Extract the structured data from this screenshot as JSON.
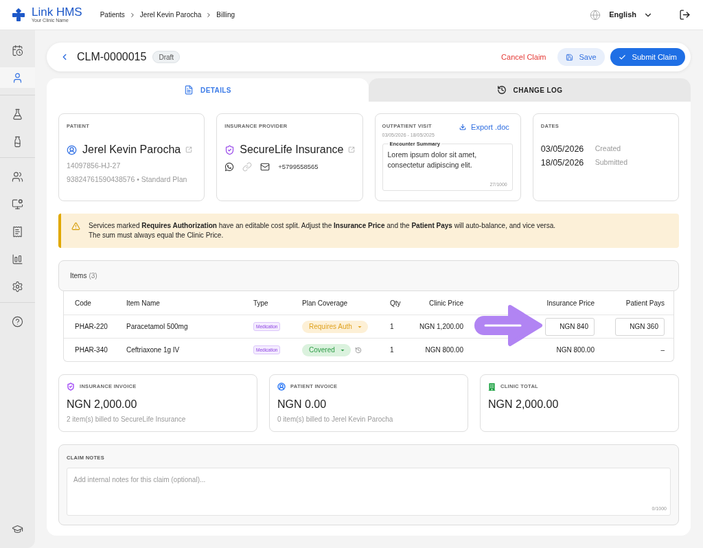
{
  "top_bar": {
    "logo": {
      "name": "Link HMS",
      "subtitle": "Your Clinic Name"
    },
    "breadcrumbs": [
      "Patients",
      "Jerel Kevin Parocha",
      "Billing"
    ],
    "language": "English"
  },
  "sidebar": {
    "groups": [
      {
        "items": [
          {
            "selected": false
          },
          {
            "selected": true
          }
        ]
      },
      {
        "items": [
          {
            "selected": false
          },
          {
            "selected": false
          }
        ]
      },
      {
        "items": [
          {
            "selected": false
          },
          {
            "selected": false
          },
          {
            "selected": false
          },
          {
            "selected": false
          },
          {
            "selected": false
          }
        ]
      },
      {
        "items": [
          {
            "selected": false
          }
        ]
      }
    ],
    "bottom_item": {
      "selected": false
    }
  },
  "header": {
    "claim_id": "CLM-0000015",
    "status": "Draft",
    "actions": [
      {
        "kind": "text",
        "label": "Cancel Claim"
      },
      {
        "kind": "secondary",
        "label": "Save"
      },
      {
        "kind": "primary",
        "label": "Submit Claim"
      }
    ]
  },
  "tabs": [
    {
      "label": "DETAILS",
      "selected": true
    },
    {
      "label": "CHANGE LOG",
      "selected": false
    }
  ],
  "patient_card": {
    "label": "PATIENT",
    "name": "Jerel Kevin Parocha",
    "patient_id": "14097856-HJ-27",
    "details": "93824761590438576 • Standard Plan"
  },
  "insurance_card": {
    "label": "INSURANCE PROVIDER",
    "name": "SecureLife Insurance",
    "contacts": [
      {
        "disabled": false
      },
      {
        "disabled": true
      },
      {
        "disabled": false
      }
    ],
    "phone": "+5799558565"
  },
  "visit_card": {
    "label": "OUTPATIENT VISIT",
    "date_range": "03/05/2026 - 18/05/2025",
    "export_label": "Export .doc",
    "summary": {
      "label": "Encounter Summary",
      "value": "Lorem ipsum dolor sit amet, consectetur adipiscing elit.",
      "counter": "27/1000"
    }
  },
  "dates_card": {
    "label": "DATES",
    "entries": [
      {
        "date": "03/05/2026",
        "event": "Created"
      },
      {
        "date": "18/05/2026",
        "event": "Submitted"
      }
    ]
  },
  "alert": {
    "lines": [
      "Services marked **Requires Authorization** have an editable cost split. Adjust the **Insurance Price** and the **Patient Pays** will auto-balance, and vice versa.",
      "The sum must always equal the Clinic Price."
    ]
  },
  "items": {
    "title": "Items",
    "count": "(3)",
    "columns": [
      "Code",
      "Item Name",
      "Type",
      "Plan Coverage",
      "Qty",
      "Clinic Price",
      "Insurance Price",
      "Patient Pays"
    ],
    "rows": [
      {
        "code": "PHAR-220",
        "name": "Paracetamol 500mg",
        "type": "Medication",
        "coverage": {
          "label": "Requires Auth",
          "kind": "auth",
          "history": false
        },
        "qty": "1",
        "clinic_price": "NGN 1,200.00",
        "editable": true,
        "insurance_price": "NGN 840",
        "patient_pays": "NGN 360"
      },
      {
        "code": "PHAR-340",
        "name": "Ceftriaxone 1g IV",
        "type": "Medication",
        "coverage": {
          "label": "Covered",
          "kind": "covered",
          "history": true
        },
        "qty": "1",
        "clinic_price": "NGN 800.00",
        "editable": false,
        "insurance_price": "NGN 800.00",
        "patient_pays": "–"
      }
    ]
  },
  "invoices": [
    {
      "label": "INSURANCE INVOICE",
      "color": "#a855f7",
      "amount": "NGN 2,000.00",
      "note": "2 item(s) billed to SecureLife Insurance"
    },
    {
      "label": "PATIENT INVOICE",
      "color": "#3b82f6",
      "amount": "NGN 0.00",
      "note": "0 item(s) billed to Jerel Kevin Parocha"
    },
    {
      "label": "CLINIC TOTAL",
      "color": "#22a447",
      "amount": "NGN 2,000.00"
    }
  ],
  "notes": {
    "label": "CLAIM NOTES",
    "placeholder": "Add internal notes for this claim (optional)...",
    "counter": "0/1000"
  }
}
